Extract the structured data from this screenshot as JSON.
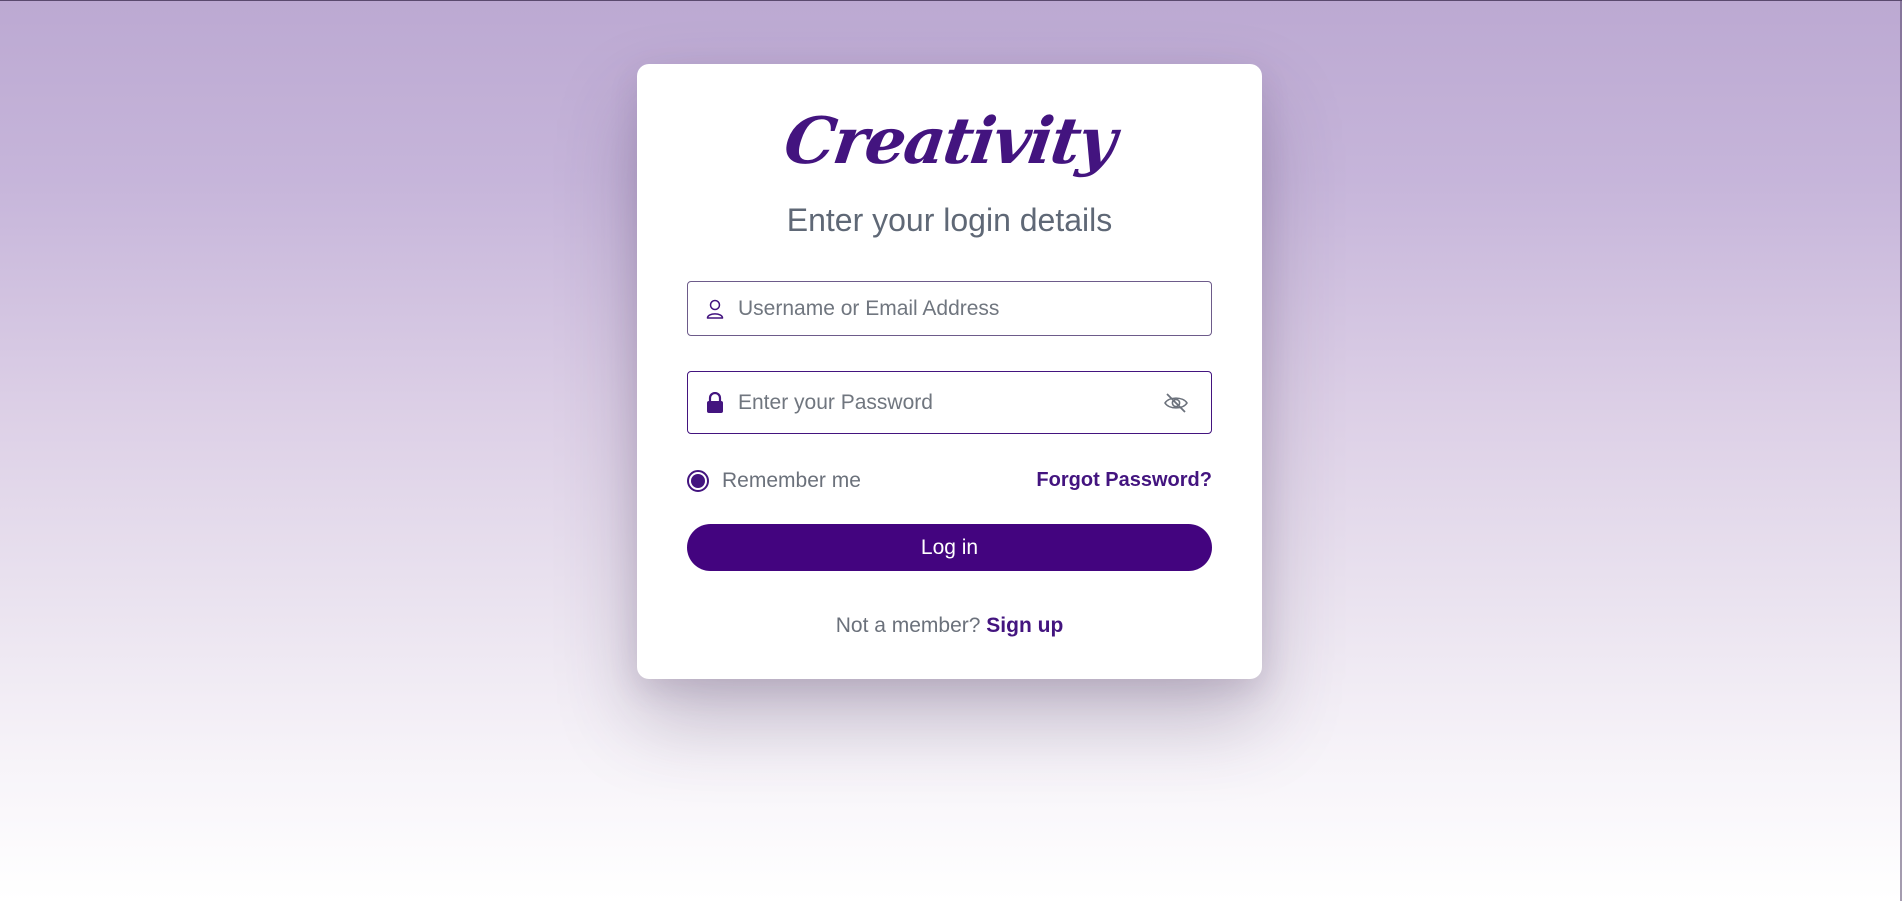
{
  "brand": {
    "logo_text": "Creativity",
    "accent_color": "#43147f"
  },
  "login_form": {
    "subtitle": "Enter your login details",
    "username": {
      "placeholder": "Username or Email Address",
      "value": "",
      "icon": "user-icon"
    },
    "password": {
      "placeholder": "Enter your Password",
      "value": "",
      "icon": "lock-icon",
      "toggle_icon": "eye-slash-icon"
    },
    "remember_me": {
      "label": "Remember me",
      "checked": true
    },
    "forgot_password_label": "Forgot Password?",
    "submit_label": "Log in",
    "signup_prompt": "Not a member?",
    "signup_link_label": "Sign up"
  }
}
